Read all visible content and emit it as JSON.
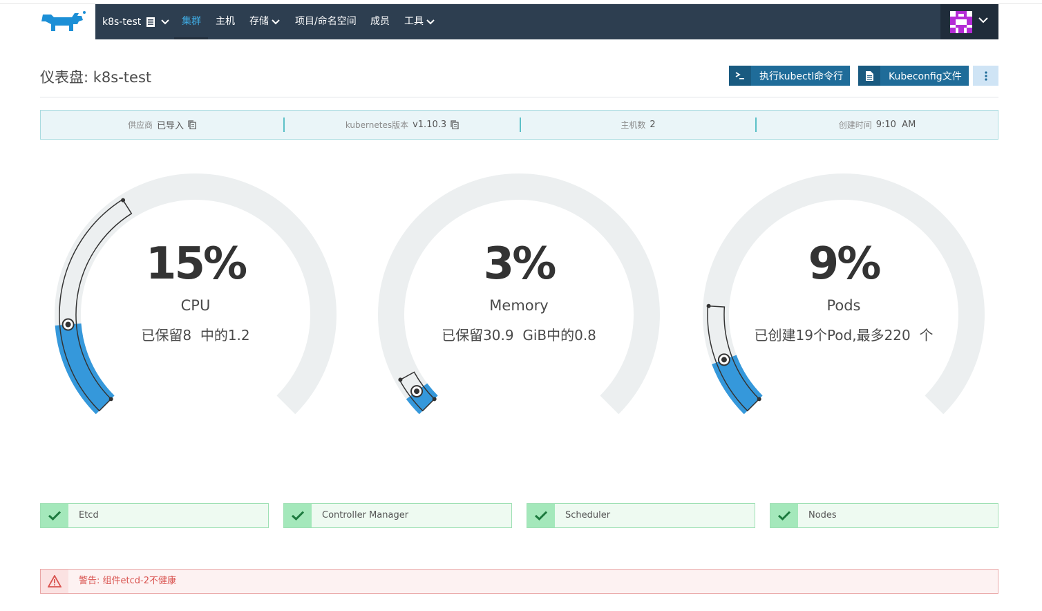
{
  "nav": {
    "cluster_name": "k8s-test",
    "items": [
      {
        "label": "集群",
        "active": true,
        "dropdown": false
      },
      {
        "label": "主机",
        "active": false,
        "dropdown": false
      },
      {
        "label": "存储",
        "active": false,
        "dropdown": true
      },
      {
        "label": "项目/命名空间",
        "active": false,
        "dropdown": false
      },
      {
        "label": "成员",
        "active": false,
        "dropdown": false
      },
      {
        "label": "工具",
        "active": false,
        "dropdown": true
      }
    ],
    "logo_icon": "rancher-cow-icon",
    "avatar_icon": "identicon-avatar"
  },
  "header": {
    "title": "仪表盘: k8s-test",
    "kubectl_button": "执行kubectl命令行",
    "kubeconfig_button": "Kubeconfig文件",
    "more_icon": "vertical-dots-icon"
  },
  "info": {
    "provider_label": "供应商",
    "provider_value": "已导入",
    "version_label": "kubernetes版本",
    "version_value": "v1.10.3",
    "hosts_label": "主机数",
    "hosts_value": "2",
    "created_label": "创建时间",
    "created_value": "9:10  AM"
  },
  "gauges": [
    {
      "value_text": "15%",
      "label": "CPU",
      "detail": "已保留8  中的1.2",
      "used_fraction": 0.15,
      "reserved_fraction": 0.38
    },
    {
      "value_text": "3%",
      "label": "Memory",
      "detail": "已保留30.9  GiB中的0.8",
      "used_fraction": 0.03,
      "reserved_fraction": 0.06
    },
    {
      "value_text": "9%",
      "label": "Pods",
      "detail": "已创建19个Pod,最多220  个",
      "used_fraction": 0.09,
      "reserved_fraction": 0.18
    }
  ],
  "components": [
    {
      "name": "Etcd",
      "status": "healthy"
    },
    {
      "name": "Controller Manager",
      "status": "healthy"
    },
    {
      "name": "Scheduler",
      "status": "healthy"
    },
    {
      "name": "Nodes",
      "status": "healthy"
    }
  ],
  "alert": {
    "message": "警告: 组件etcd-2不健康"
  },
  "colors": {
    "nav_bg": "#2d3e50",
    "accent_blue": "#3598db",
    "button_blue": "#1f6c99",
    "gauge_track": "#eceff0",
    "ok_green": "#a4e8bb",
    "danger_red": "#d9534f"
  }
}
